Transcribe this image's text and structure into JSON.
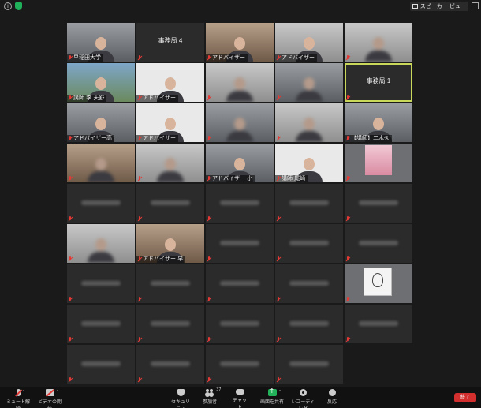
{
  "topbar": {
    "view_label": "スピーカー ビュー"
  },
  "tiles": [
    {
      "name": "早稲田大学",
      "kind": "video",
      "bg": "bg-office"
    },
    {
      "name": "事務局 4",
      "kind": "name-only",
      "center": true
    },
    {
      "name": "アドバイザー",
      "kind": "video",
      "bg": "bg-warm"
    },
    {
      "name": "アドバイザー",
      "kind": "video",
      "bg": "bg-light"
    },
    {
      "name": "",
      "kind": "video",
      "bg": "bg-light",
      "blur": true
    },
    {
      "name": "講師 李 天舒",
      "kind": "video",
      "bg": "bg-building"
    },
    {
      "name": "アドバイザー",
      "kind": "video",
      "bg": "bg-white"
    },
    {
      "name": "",
      "kind": "video",
      "bg": "bg-light",
      "blur": true
    },
    {
      "name": "",
      "kind": "video",
      "bg": "bg-office",
      "blur": true
    },
    {
      "name": "事務局 1",
      "kind": "name-only",
      "center": true,
      "active": true
    },
    {
      "name": "アドバイザー高",
      "kind": "video",
      "bg": "bg-office"
    },
    {
      "name": "アドバイザー",
      "kind": "video",
      "bg": "bg-white"
    },
    {
      "name": "",
      "kind": "video",
      "bg": "bg-office",
      "blur": true
    },
    {
      "name": "",
      "kind": "video",
      "bg": "bg-light",
      "blur": true
    },
    {
      "name": "【講師】二木久",
      "kind": "video",
      "bg": "bg-office"
    },
    {
      "name": "",
      "kind": "video",
      "bg": "bg-warm",
      "blur": true
    },
    {
      "name": "",
      "kind": "video",
      "bg": "bg-light",
      "blur": true
    },
    {
      "name": "アドバイザー 小",
      "kind": "video",
      "bg": "bg-office"
    },
    {
      "name": "講師 尾崎",
      "kind": "video",
      "bg": "bg-white"
    },
    {
      "name": "",
      "kind": "doll"
    },
    {
      "name": "",
      "kind": "blurname"
    },
    {
      "name": "",
      "kind": "blurname"
    },
    {
      "name": "",
      "kind": "blurname"
    },
    {
      "name": "",
      "kind": "blurname"
    },
    {
      "name": "",
      "kind": "blurname"
    },
    {
      "name": "",
      "kind": "video",
      "bg": "bg-light",
      "blur": true
    },
    {
      "name": "アドバイザー 早",
      "kind": "video",
      "bg": "bg-warm"
    },
    {
      "name": "",
      "kind": "blurname"
    },
    {
      "name": "",
      "kind": "blurname"
    },
    {
      "name": "",
      "kind": "blurname"
    },
    {
      "name": "",
      "kind": "blurname"
    },
    {
      "name": "",
      "kind": "blurname"
    },
    {
      "name": "",
      "kind": "blurname"
    },
    {
      "name": "",
      "kind": "blurname"
    },
    {
      "name": "",
      "kind": "sketch"
    },
    {
      "name": "",
      "kind": "blurname"
    },
    {
      "name": "",
      "kind": "blurname"
    },
    {
      "name": "",
      "kind": "blurname"
    },
    {
      "name": "",
      "kind": "blurname"
    },
    {
      "name": "",
      "kind": "blurname"
    },
    {
      "name": "",
      "kind": "blurname"
    },
    {
      "name": "",
      "kind": "blurname"
    },
    {
      "name": "",
      "kind": "blurname"
    },
    {
      "name": "",
      "kind": "blurname"
    }
  ],
  "toolbar": {
    "mute": "ミュート解除",
    "video": "ビデオの開始",
    "security": "セキュリティ",
    "participants": "参加者",
    "participants_count": "37",
    "chat": "チャット",
    "share": "画面を共有",
    "record": "レコーディング",
    "reactions": "反応",
    "end": "終了"
  },
  "colors": {
    "active_outline": "#c9d85a",
    "mute_red": "#e53935",
    "share_green": "#22b35a",
    "end_red": "#d32f2f"
  }
}
